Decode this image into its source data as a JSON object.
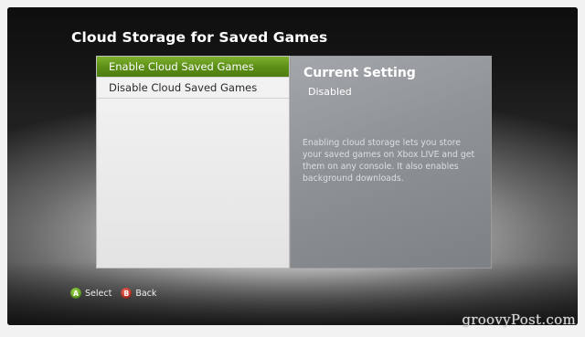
{
  "page": {
    "title": "Cloud Storage for Saved Games"
  },
  "menu": {
    "items": [
      {
        "label": "Enable Cloud Saved Games",
        "selected": true
      },
      {
        "label": "Disable Cloud Saved Games",
        "selected": false
      }
    ]
  },
  "info": {
    "heading": "Current Setting",
    "value": "Disabled",
    "description": "Enabling cloud storage lets you store your saved games on Xbox LIVE and get them on any console. It also enables background downloads."
  },
  "footer": {
    "select": {
      "button": "A",
      "label": "Select",
      "icon": "a-button-icon",
      "color": "#5a9a1e"
    },
    "back": {
      "button": "B",
      "label": "Back",
      "icon": "b-button-icon",
      "color": "#c0281c"
    }
  },
  "watermark": "groovyPost.com",
  "colors": {
    "selected_item": "#5c8f17",
    "info_panel": "#8e9296"
  }
}
